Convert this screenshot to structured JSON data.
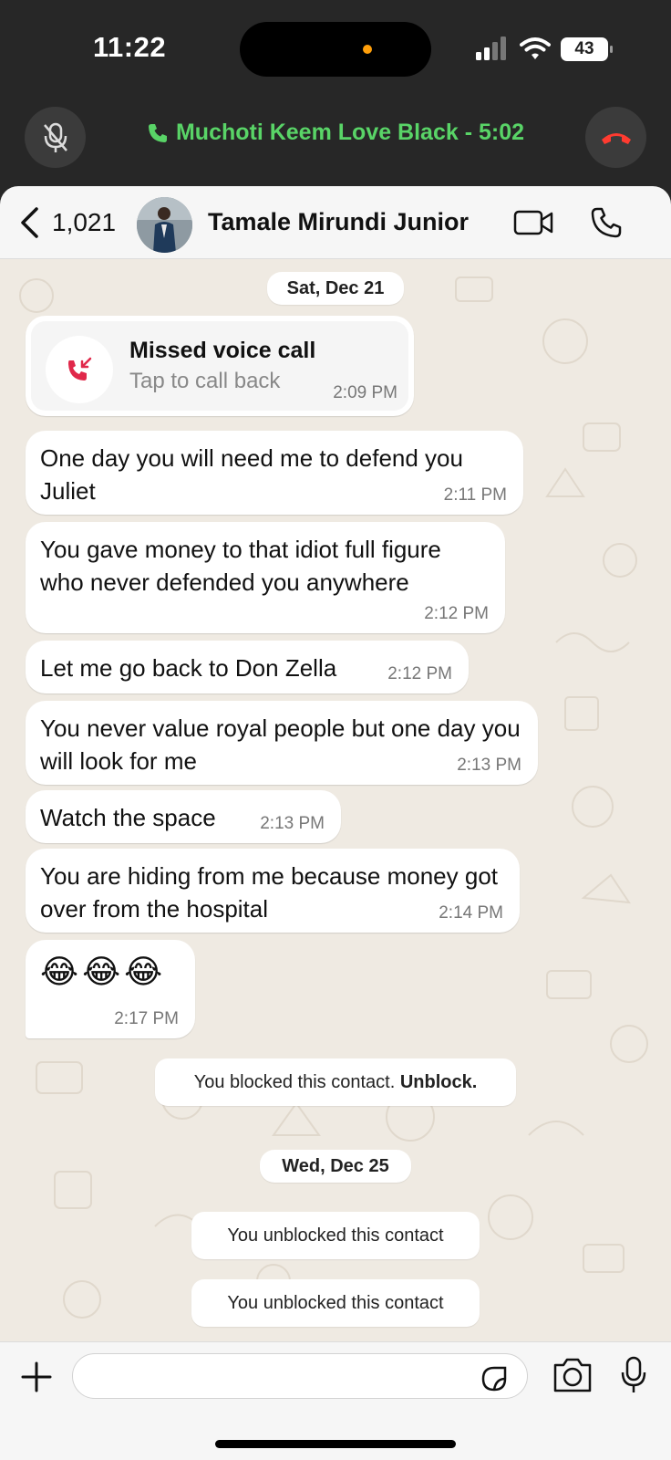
{
  "status_bar": {
    "time": "11:22",
    "battery": "43"
  },
  "call_bar": {
    "text": "Muchoti Keem Love Black - 5:02",
    "accent": "#59d467",
    "end_color": "#ff3b30"
  },
  "header": {
    "back_count": "1,021",
    "contact_name": "Tamale Mirundi Junior"
  },
  "chat": {
    "date1": "Sat, Dec 21",
    "missed_call": {
      "title": "Missed voice call",
      "subtitle": "Tap to call back",
      "time": "2:09 PM"
    },
    "messages": [
      {
        "text": "One day you will need me to defend you Juliet",
        "time": "2:11 PM"
      },
      {
        "text": "You gave money to that idiot full figure who never defended you anywhere",
        "time": "2:12 PM"
      },
      {
        "text": "Let me go back to Don Zella",
        "time": "2:12 PM"
      },
      {
        "text": "You never value royal people but one  day you will look for me",
        "time": "2:13 PM"
      },
      {
        "text": "Watch the space",
        "time": "2:13 PM"
      },
      {
        "text": "You are hiding from me because money got over from the hospital",
        "time": "2:14 PM"
      },
      {
        "text": "😂😂😂",
        "time": "2:17 PM"
      }
    ],
    "blocked_notice": {
      "text": "You blocked this contact. ",
      "action": "Unblock."
    },
    "date2": "Wed, Dec 25",
    "unblocked_1": "You unblocked this contact",
    "unblocked_2": "You unblocked this contact"
  },
  "input": {
    "placeholder": ""
  }
}
